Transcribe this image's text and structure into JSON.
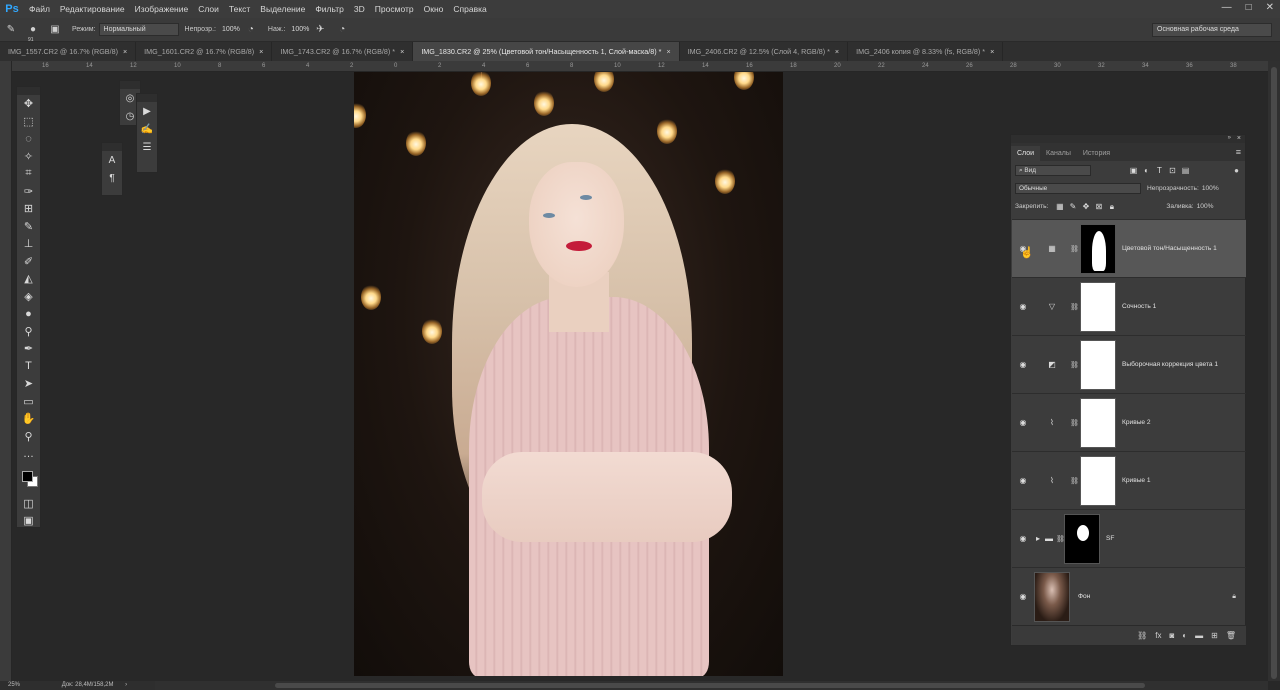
{
  "app": {
    "logo": "Ps",
    "menu": [
      "Файл",
      "Редактирование",
      "Изображение",
      "Слои",
      "Текст",
      "Выделение",
      "Фильтр",
      "3D",
      "Просмотр",
      "Окно",
      "Справка"
    ],
    "window_controls": [
      "—",
      "□",
      "✕"
    ]
  },
  "options": {
    "brush_size": "91",
    "mode_label": "Режим:",
    "mode_value": "Нормальный",
    "opacity_label": "Непрозр.:",
    "opacity_value": "100%",
    "flow_label": "Наж.:",
    "flow_value": "100%",
    "workspace": "Основная рабочая среда"
  },
  "tabs": [
    {
      "label": "IMG_1557.CR2 @ 16.7% (RGB/8)",
      "close": "×",
      "active": false
    },
    {
      "label": "IMG_1601.CR2 @ 16.7% (RGB/8)",
      "close": "×",
      "active": false
    },
    {
      "label": "IMG_1743.CR2 @ 16.7% (RGB/8) *",
      "close": "×",
      "active": false
    },
    {
      "label": "IMG_1830.CR2 @ 25% (Цветовой тон/Насыщенность 1, Слой-маска/8) *",
      "close": "×",
      "active": true
    },
    {
      "label": "IMG_2406.CR2 @ 12.5% (Слой 4, RGB/8) *",
      "close": "×",
      "active": false
    },
    {
      "label": "IMG_2406 копия @ 8.33% (fs, RGB/8) *",
      "close": "×",
      "active": false
    }
  ],
  "ruler_ticks": [
    "16",
    "14",
    "12",
    "10",
    "8",
    "6",
    "4",
    "2",
    "0",
    "2",
    "4",
    "6",
    "8",
    "10",
    "12",
    "14",
    "16",
    "18",
    "20",
    "22",
    "24",
    "26",
    "28",
    "30",
    "32",
    "34",
    "36",
    "38"
  ],
  "layers_panel": {
    "tabs": [
      "Слои",
      "Каналы",
      "История"
    ],
    "filter_label": "Вид",
    "blend_mode": "Обычные",
    "opacity_label": "Непрозрачность:",
    "opacity_value": "100%",
    "lock_label": "Закрепить:",
    "fill_label": "Заливка:",
    "fill_value": "100%",
    "layers": [
      {
        "name": "Цветовой тон/Насыщенность 1",
        "type": "hue-saturation",
        "icon": "▦",
        "mask": "dark",
        "active": true
      },
      {
        "name": "Сочность 1",
        "type": "vibrance",
        "icon": "▽",
        "mask": "white",
        "active": false
      },
      {
        "name": "Выборочная коррекция цвета 1",
        "type": "selective-color",
        "icon": "◩",
        "mask": "white",
        "active": false
      },
      {
        "name": "Кривые 2",
        "type": "curves",
        "icon": "⌇",
        "mask": "white",
        "active": false
      },
      {
        "name": "Кривые 1",
        "type": "curves",
        "icon": "⌇",
        "mask": "white",
        "active": false
      },
      {
        "name": "SF",
        "type": "group",
        "icon": "▸",
        "mask": "dark",
        "active": false
      },
      {
        "name": "Фон",
        "type": "background",
        "icon": "",
        "mask": "photo",
        "active": false
      }
    ]
  },
  "status": {
    "zoom": "25%",
    "doc": "Док: 28,4M/158,2M",
    "arrow": "›"
  }
}
